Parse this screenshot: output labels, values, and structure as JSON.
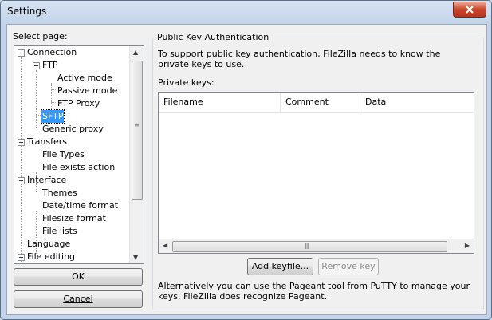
{
  "window": {
    "title": "Settings"
  },
  "select_page_label": "Select page:",
  "tree": {
    "items": [
      {
        "label": "Connection"
      },
      {
        "label": "FTP"
      },
      {
        "label": "Active mode"
      },
      {
        "label": "Passive mode"
      },
      {
        "label": "FTP Proxy"
      },
      {
        "label": "SFTP"
      },
      {
        "label": "Generic proxy"
      },
      {
        "label": "Transfers"
      },
      {
        "label": "File Types"
      },
      {
        "label": "File exists action"
      },
      {
        "label": "Interface"
      },
      {
        "label": "Themes"
      },
      {
        "label": "Date/time format"
      },
      {
        "label": "Filesize format"
      },
      {
        "label": "File lists"
      },
      {
        "label": "Language"
      },
      {
        "label": "File editing"
      }
    ],
    "selected": "SFTP"
  },
  "buttons": {
    "ok": "OK",
    "cancel": "Cancel",
    "add_keyfile": "Add keyfile...",
    "remove_key": "Remove key"
  },
  "panel": {
    "title": "Public Key Authentication",
    "description": "To support public key authentication, FileZilla needs to know the private keys to use.",
    "private_keys_label": "Private keys:",
    "columns": [
      "Filename",
      "Comment",
      "Data"
    ],
    "footer": "Alternatively you can use the Pageant tool from PuTTY to manage your keys, FileZilla does recognize Pageant."
  }
}
